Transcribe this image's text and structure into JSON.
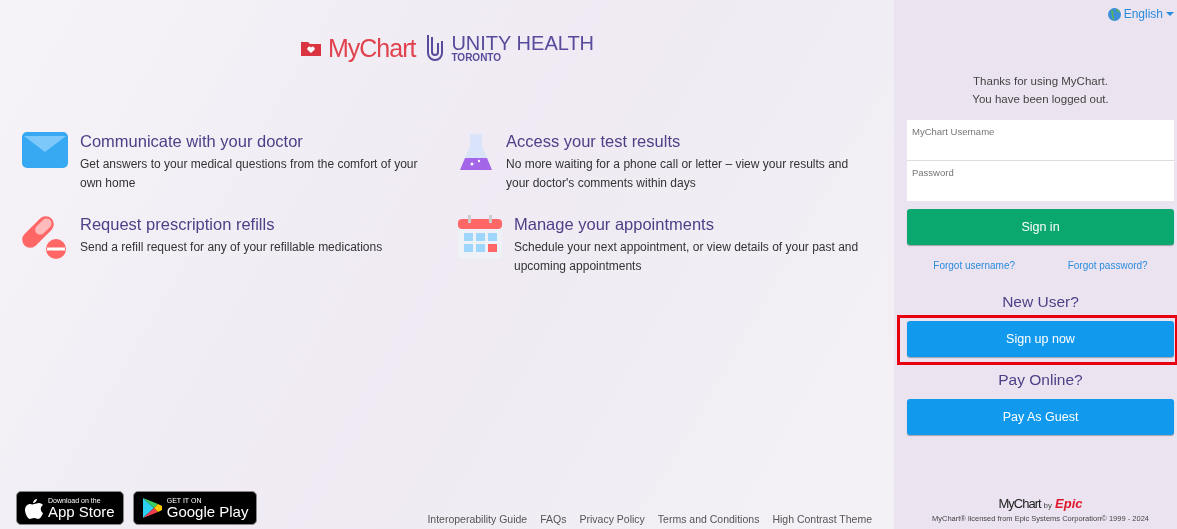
{
  "logo": {
    "app": "MyChart",
    "org": "UNITY HEALTH",
    "org_sub": "TORONTO"
  },
  "features": [
    {
      "title": "Communicate with your doctor",
      "text": "Get answers to your medical questions from the comfort of your own home"
    },
    {
      "title": "Access your test results",
      "text": "No more waiting for a phone call or letter – view your results and your doctor's comments within days"
    },
    {
      "title": "Request prescription refills",
      "text": "Send a refill request for any of your refillable medications"
    },
    {
      "title": "Manage your appointments",
      "text": "Schedule your next appointment, or view details of your past and upcoming appointments"
    }
  ],
  "stores": [
    {
      "small": "Download on the",
      "big": "App Store"
    },
    {
      "small": "GET IT ON",
      "big": "Google Play"
    }
  ],
  "footer_links": [
    "Interoperability Guide",
    "FAQs",
    "Privacy Policy",
    "Terms and Conditions",
    "High Contrast Theme"
  ],
  "sidebar": {
    "language": "English",
    "message": [
      "Thanks for using MyChart.",
      "You have been logged out."
    ],
    "username": {
      "placeholder": "MyChart Username"
    },
    "password": {
      "placeholder": "Password"
    },
    "sign_in": "Sign in",
    "forgot": [
      "Forgot username?",
      "Forgot password?"
    ],
    "new_user": "New User?",
    "sign_up": {
      "label": "Sign up now",
      "highlighted": true
    },
    "pay_online": "Pay Online?",
    "pay_guest": "Pay As Guest",
    "brand": {
      "app": "MyChart",
      "by": "by",
      "vendor": "Epic"
    },
    "copyright": "MyChart® licensed from Epic Systems Corporation© 1999 - 2024"
  }
}
